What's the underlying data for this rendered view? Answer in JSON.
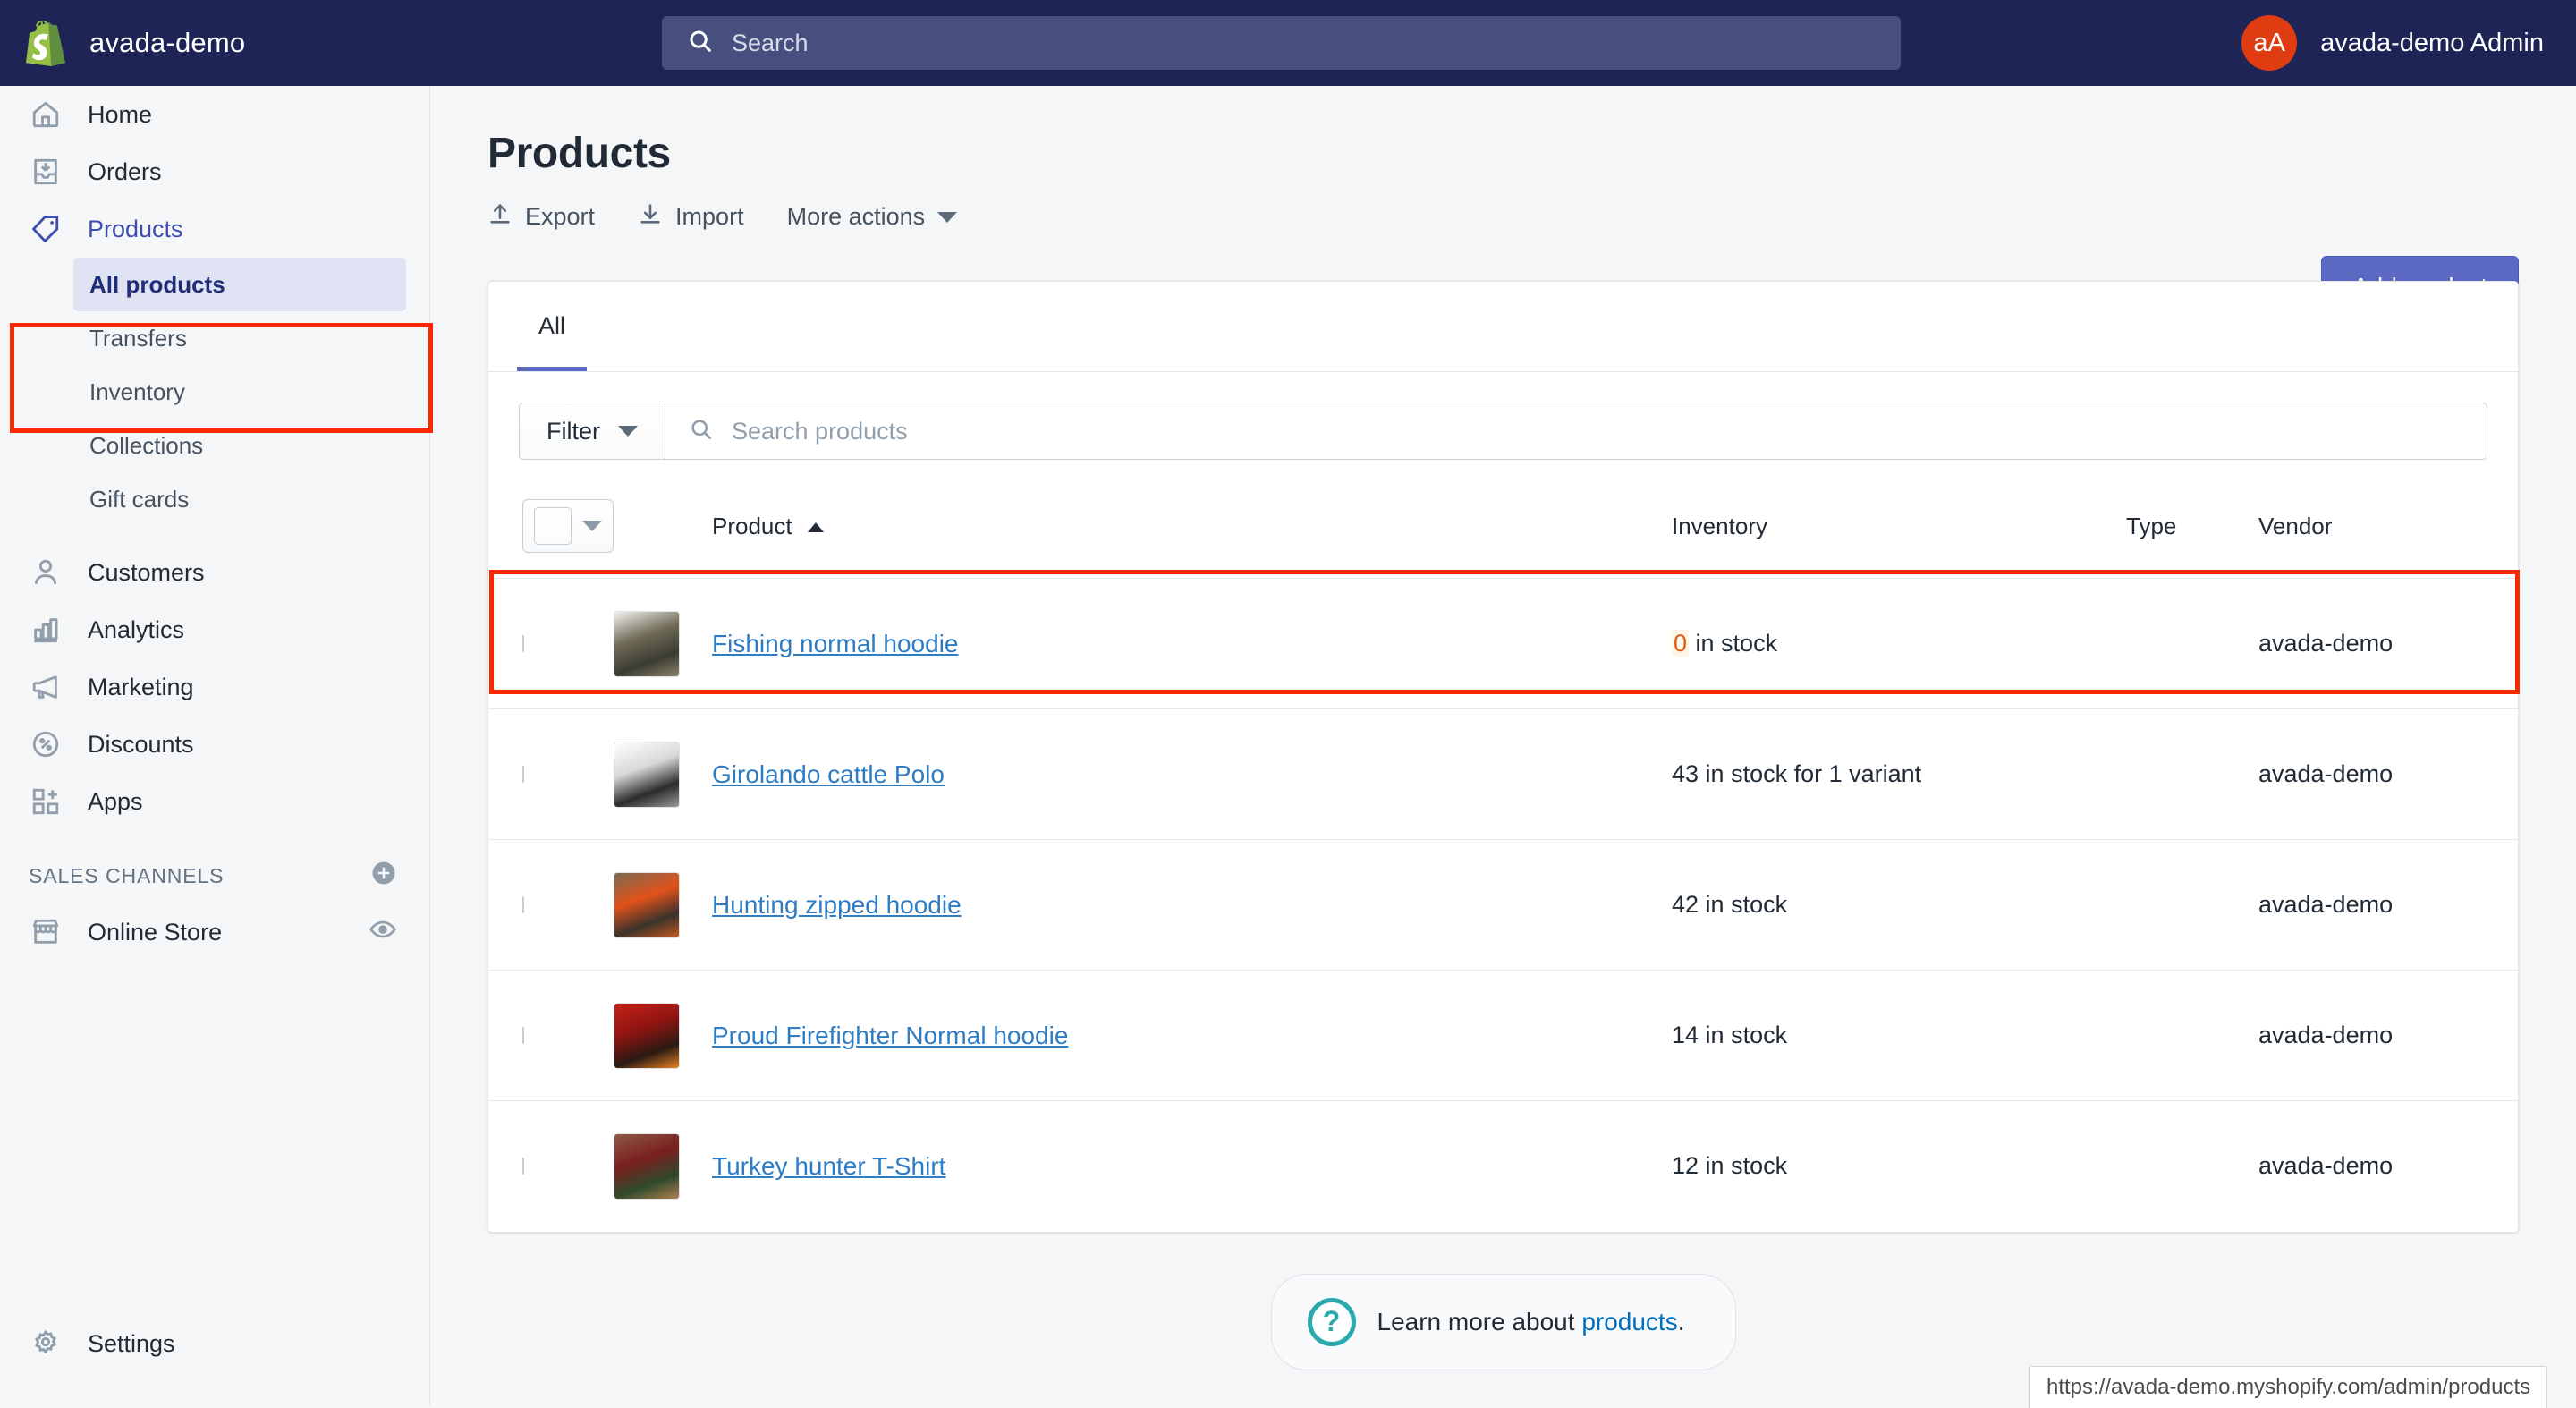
{
  "topbar": {
    "brand_name": "avada-demo",
    "logo_icon": "shopify-bag-icon",
    "search_icon": "search-icon",
    "search_placeholder": "Search",
    "search_value": "",
    "avatar_initials": "aA",
    "avatar_color": "#e03c11",
    "user_name": "avada-demo Admin",
    "background_color": "#1f2456"
  },
  "sidebar": {
    "items": [
      {
        "label": "Home",
        "icon": "home-icon",
        "active": false
      },
      {
        "label": "Orders",
        "icon": "orders-inbox-icon",
        "active": false
      },
      {
        "label": "Products",
        "icon": "product-tag-icon",
        "active": true
      },
      {
        "label": "Customers",
        "icon": "customer-person-icon",
        "active": false
      },
      {
        "label": "Analytics",
        "icon": "analytics-bar-chart-icon",
        "active": false
      },
      {
        "label": "Marketing",
        "icon": "marketing-megaphone-icon",
        "active": false
      },
      {
        "label": "Discounts",
        "icon": "discount-percent-icon",
        "active": false
      },
      {
        "label": "Apps",
        "icon": "apps-grid-plus-icon",
        "active": false
      }
    ],
    "products_subitems": [
      {
        "label": "All products",
        "selected": true
      },
      {
        "label": "Transfers",
        "selected": false
      },
      {
        "label": "Inventory",
        "selected": false
      },
      {
        "label": "Collections",
        "selected": false
      },
      {
        "label": "Gift cards",
        "selected": false
      }
    ],
    "sales_channels_label": "SALES CHANNELS",
    "sales_channels_add_icon": "plus-circle-icon",
    "online_store": {
      "label": "Online Store",
      "icon": "storefront-icon",
      "action_icon": "eye-icon"
    },
    "settings": {
      "label": "Settings",
      "icon": "gear-icon"
    },
    "accent_color": "#3f4eae"
  },
  "annotations": {
    "highlight_color": "#fa2800",
    "regions": [
      "products-nav-group",
      "first-product-row"
    ]
  },
  "page": {
    "title": "Products",
    "actions": [
      {
        "label": "Export",
        "icon": "export-up-arrow-icon"
      },
      {
        "label": "Import",
        "icon": "import-down-arrow-icon"
      },
      {
        "label": "More actions",
        "icon": "chevron-down-icon"
      }
    ],
    "primary_button": {
      "label": "Add product",
      "color": "#5c6ac4"
    }
  },
  "card": {
    "tabs": [
      {
        "label": "All",
        "active": true
      }
    ],
    "filter_button": {
      "label": "Filter",
      "icon": "chevron-down-icon"
    },
    "search": {
      "icon": "search-icon",
      "placeholder": "Search products",
      "value": ""
    }
  },
  "table": {
    "select_all": {
      "icon": "checkbox-dropdown-icon",
      "checked": false
    },
    "columns": [
      {
        "key": "product",
        "label": "Product",
        "sort": "ascending",
        "sort_icon": "caret-up-icon"
      },
      {
        "key": "inventory",
        "label": "Inventory"
      },
      {
        "key": "type",
        "label": "Type"
      },
      {
        "key": "vendor",
        "label": "Vendor"
      }
    ],
    "rows": [
      {
        "name": "Fishing normal hoodie",
        "inventory_count": "0",
        "inventory_suffix": " in stock",
        "inventory_low": true,
        "type": "",
        "vendor": "avada-demo",
        "checked": false,
        "thumb_colors": [
          "#f2f2f0",
          "#6f6a55",
          "#3b3b33",
          "#8b8466"
        ],
        "highlighted": true
      },
      {
        "name": "Girolando cattle Polo",
        "inventory_count": "43",
        "inventory_suffix": " in stock for 1 variant",
        "inventory_low": false,
        "type": "",
        "vendor": "avada-demo",
        "checked": false,
        "thumb_colors": [
          "#ffffff",
          "#d8d8d8",
          "#2b2b2b",
          "#9a9a9a"
        ],
        "highlighted": false
      },
      {
        "name": "Hunting zipped hoodie",
        "inventory_count": "42",
        "inventory_suffix": " in stock",
        "inventory_low": false,
        "type": "",
        "vendor": "avada-demo",
        "checked": false,
        "thumb_colors": [
          "#7b6a52",
          "#e2521a",
          "#3a332b",
          "#c8581f"
        ],
        "highlighted": false
      },
      {
        "name": "Proud Firefighter Normal hoodie",
        "inventory_count": "14",
        "inventory_suffix": " in stock",
        "inventory_low": false,
        "type": "",
        "vendor": "avada-demo",
        "checked": false,
        "thumb_colors": [
          "#c42118",
          "#8e1410",
          "#2a1a14",
          "#e8811f"
        ],
        "highlighted": false
      },
      {
        "name": "Turkey hunter T-Shirt",
        "inventory_count": "12",
        "inventory_suffix": " in stock",
        "inventory_low": false,
        "type": "",
        "vendor": "avada-demo",
        "checked": false,
        "thumb_colors": [
          "#8d5a43",
          "#7a1f1f",
          "#2f4a2a",
          "#b08050"
        ],
        "highlighted": false
      }
    ]
  },
  "footer": {
    "help_icon": "question-circle-icon",
    "text_before": "Learn more about ",
    "link_label": "products",
    "text_after": "."
  },
  "status_bar": {
    "url": "https://avada-demo.myshopify.com/admin/products"
  }
}
